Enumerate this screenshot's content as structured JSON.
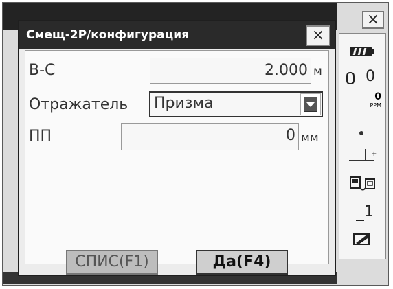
{
  "outer_window": {
    "close_symbol": "×"
  },
  "dialog": {
    "title": "Смещ-2Р/конфигурация",
    "close_symbol": "×",
    "fields": {
      "hv": {
        "label": "В-С",
        "value": "2.000",
        "unit": "м"
      },
      "reflector": {
        "label": "Отражатель",
        "value": "Призма"
      },
      "prism_constant": {
        "label": "ПП",
        "value": "0",
        "unit": "мм"
      }
    },
    "softkeys": {
      "f1": "СПИС(F1)",
      "f4": "Да(F4)"
    }
  },
  "status_bar": {
    "battery_icon": "battery-icon",
    "prism_constant": "0",
    "ppm_value": "0",
    "ppm_label": "PPM",
    "sd_number": "1"
  }
}
